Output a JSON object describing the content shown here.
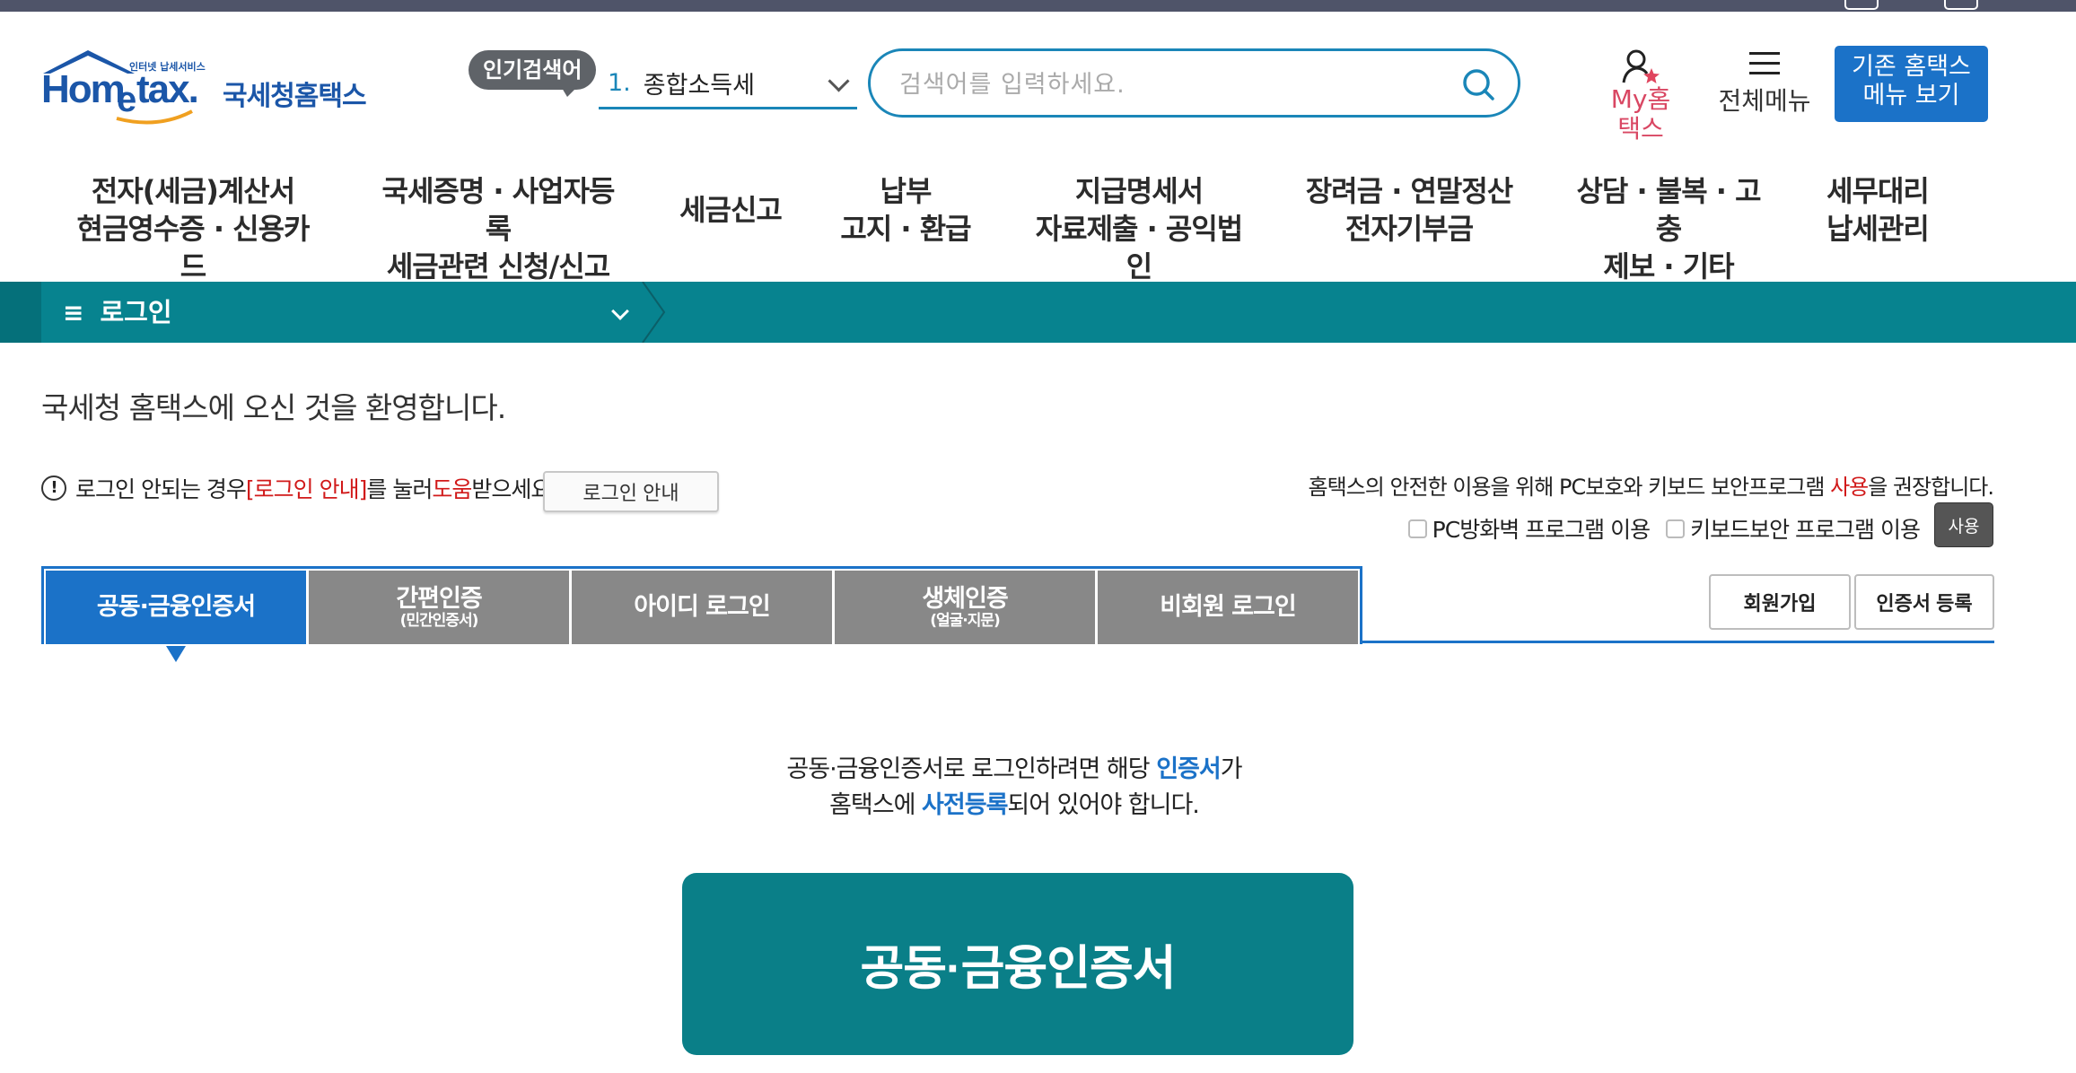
{
  "header": {
    "logo_small": "인터넷 납세서비스",
    "logo_main": "Hometax",
    "logo_korean": "국세청홈택스",
    "popular_badge": "인기검색어",
    "popular_rank": "1.",
    "popular_term": "종합소득세",
    "search_placeholder": "검색어를 입력하세요.",
    "my_home": "My홈택스",
    "all_menu": "전체메뉴",
    "old_menu_line1": "기존 홈택스",
    "old_menu_line2": "메뉴 보기"
  },
  "nav": [
    {
      "line1": "전자(세금)계산서",
      "line2": "현금영수증 · 신용카드"
    },
    {
      "line1": "국세증명 · 사업자등록",
      "line2": "세금관련 신청/신고"
    },
    {
      "line1": "세금신고",
      "line2": ""
    },
    {
      "line1": "납부",
      "line2": "고지 · 환급"
    },
    {
      "line1": "지급명세서",
      "line2": "자료제출 · 공익법인"
    },
    {
      "line1": "장려금 · 연말정산",
      "line2": "전자기부금"
    },
    {
      "line1": "상담 · 불복 · 고충",
      "line2": "제보 · 기타"
    },
    {
      "line1": "세무대리",
      "line2": "납세관리"
    }
  ],
  "location": {
    "label": "로그인"
  },
  "welcome": "국세청 홈택스에 오신 것을 환영합니다.",
  "notice": {
    "part1": "로그인 안되는 경우 ",
    "link": "[로그인 안내]",
    "part2": "를 눌러 ",
    "help": "도움",
    "part3": "받으세요.",
    "guide_button": "로그인 안내"
  },
  "security": {
    "text1": "홈택스의 안전한 이용을 위해 PC보호와 키보드 보안프로그램 ",
    "use_word": "사용",
    "text2": "을 권장합니다.",
    "pc_firewall": "PC방화벽 프로그램 이용",
    "keyboard_security": "키보드보안 프로그램 이용",
    "use_button": "사용"
  },
  "tabs": [
    {
      "label": "공동·금융인증서",
      "sub": ""
    },
    {
      "label": "간편인증",
      "sub": "(민간인증서)"
    },
    {
      "label": "아이디 로그인",
      "sub": ""
    },
    {
      "label": "생체인증",
      "sub": "(얼굴·지문)"
    },
    {
      "label": "비회원 로그인",
      "sub": ""
    }
  ],
  "side_buttons": {
    "signup": "회원가입",
    "cert_register": "인증서 등록"
  },
  "description": {
    "l1_a": "공동·금융인증서로 로그인하려면 해당 ",
    "l1_b": "인증서",
    "l1_c": "가",
    "l2_a": "홈택스에 ",
    "l2_b": "사전등록",
    "l2_c": "되어 있어야 합니다."
  },
  "main_button": "공동·금융인증서",
  "colors": {
    "teal": "#07838f",
    "blue": "#1b72c8",
    "red": "#d11a1a",
    "tab_gray": "#888888"
  }
}
